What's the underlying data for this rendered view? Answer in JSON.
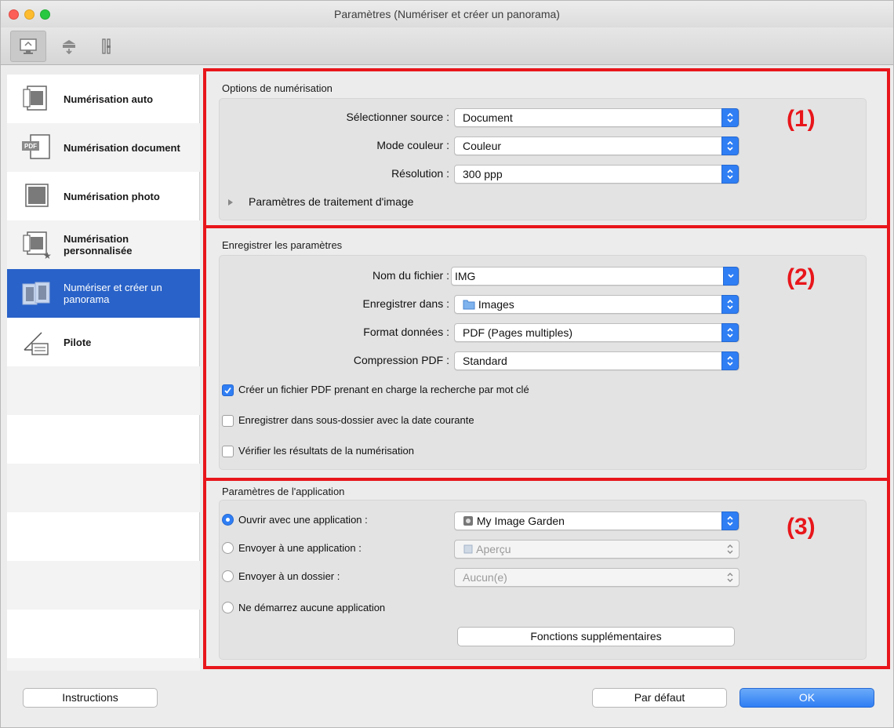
{
  "window": {
    "title": "Paramètres (Numériser et créer un panorama)"
  },
  "toolbar": {
    "tabs": [
      "scan-from-computer",
      "scan-from-panel",
      "general-settings"
    ]
  },
  "sidebar": {
    "items": [
      {
        "label": "Numérisation auto"
      },
      {
        "label": "Numérisation document"
      },
      {
        "label": "Numérisation photo"
      },
      {
        "label": "Numérisation personnalisée"
      },
      {
        "label": "Numériser et créer un panorama"
      },
      {
        "label": "Pilote"
      }
    ]
  },
  "scan_options": {
    "title": "Options de numérisation",
    "callout": "(1)",
    "source": {
      "label": "Sélectionner source :",
      "value": "Document"
    },
    "color_mode": {
      "label": "Mode couleur :",
      "value": "Couleur"
    },
    "resolution": {
      "label": "Résolution :",
      "value": "300 ppp"
    },
    "image_processing": "Paramètres de traitement d'image"
  },
  "save_settings": {
    "title": "Enregistrer les paramètres",
    "callout": "(2)",
    "file_name": {
      "label": "Nom du fichier :",
      "value": "IMG"
    },
    "save_in": {
      "label": "Enregistrer dans :",
      "value": "Images"
    },
    "data_format": {
      "label": "Format données :",
      "value": "PDF (Pages multiples)"
    },
    "pdf_compression": {
      "label": "Compression PDF :",
      "value": "Standard"
    },
    "check_keyword": {
      "label": "Créer un fichier PDF prenant en charge la recherche par mot clé",
      "checked": true
    },
    "check_subfolder": {
      "label": "Enregistrer dans sous-dossier avec la date courante",
      "checked": false
    },
    "check_results": {
      "label": "Vérifier les résultats de la numérisation",
      "checked": false
    }
  },
  "app_settings": {
    "title": "Paramètres de l'application",
    "callout": "(3)",
    "open_with": {
      "label": "Ouvrir avec une application :",
      "value": "My Image Garden",
      "selected": true
    },
    "send_to_app": {
      "label": "Envoyer à une application :",
      "value": "Aperçu",
      "selected": false
    },
    "send_to_folder": {
      "label": "Envoyer à un dossier :",
      "value": "Aucun(e)",
      "selected": false
    },
    "no_app": {
      "label": "Ne démarrez aucune application",
      "selected": false
    },
    "more_functions": "Fonctions supplémentaires"
  },
  "footer": {
    "instructions": "Instructions",
    "defaults": "Par défaut",
    "ok": "OK"
  },
  "colors": {
    "accent": "#2f7ef4",
    "callout": "#e8161b",
    "selection": "#2962c8"
  }
}
